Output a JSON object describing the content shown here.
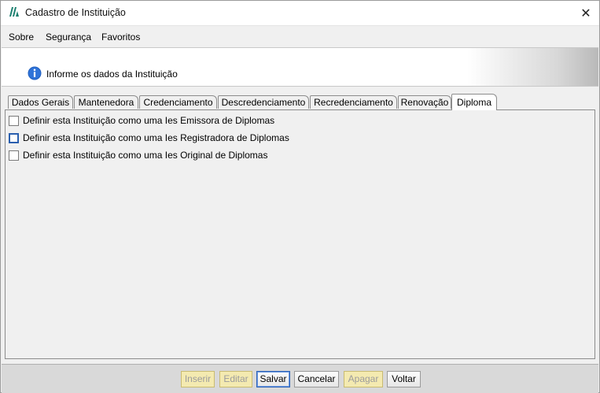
{
  "window": {
    "title": "Cadastro de Instituição",
    "close_glyph": "✕"
  },
  "menu": {
    "items": [
      {
        "label": "Sobre"
      },
      {
        "label": "Segurança"
      },
      {
        "label": "Favoritos"
      }
    ]
  },
  "banner": {
    "icon": "info-icon",
    "text": "Informe os dados da Instituição"
  },
  "tabs": {
    "items": [
      {
        "label": "Dados Gerais"
      },
      {
        "label": "Mantenedora"
      },
      {
        "label": "Credenciamento"
      },
      {
        "label": "Descredenciamento"
      },
      {
        "label": "Recredenciamento"
      },
      {
        "label": "Renovação"
      },
      {
        "label": "Diploma"
      }
    ],
    "active": "Diploma"
  },
  "diploma": {
    "options": [
      {
        "label": "Definir esta Instituição como uma Ies Emissora de Diplomas",
        "checked": false
      },
      {
        "label": "Definir esta Instituição como uma Ies Registradora de Diplomas",
        "checked": false
      },
      {
        "label": "Definir esta Instituição como uma Ies Original de Diplomas",
        "checked": false
      }
    ]
  },
  "buttons": {
    "inserir": "Inserir",
    "editar": "Editar",
    "salvar": "Salvar",
    "cancelar": "Cancelar",
    "apagar": "Apagar",
    "voltar": "Voltar"
  },
  "colors": {
    "disabled_button_bg": "#f4eab0",
    "focus_border": "#2d63b8",
    "info_icon": "#1f5fbf"
  }
}
